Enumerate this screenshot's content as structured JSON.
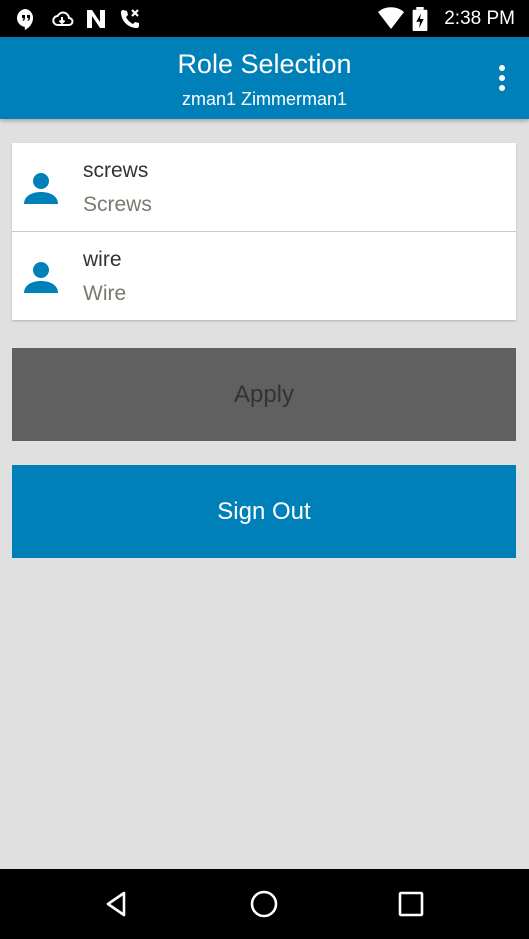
{
  "status_bar": {
    "time": "2:38 PM",
    "icons": [
      "hangouts-icon",
      "cloud-download-icon",
      "nfc-icon",
      "missed-call-icon",
      "wifi-icon",
      "battery-charging-icon"
    ]
  },
  "app_bar": {
    "title": "Role Selection",
    "subtitle": "zman1 Zimmerman1",
    "menu_icon": "more-vert-icon"
  },
  "roles": [
    {
      "name": "screws",
      "description": "Screws",
      "icon": "person-icon"
    },
    {
      "name": "wire",
      "description": "Wire",
      "icon": "person-icon"
    }
  ],
  "buttons": {
    "apply_label": "Apply",
    "sign_out_label": "Sign Out"
  },
  "nav_bar": {
    "icons": [
      "back-icon",
      "home-icon",
      "recents-icon"
    ]
  },
  "colors": {
    "accent": "#0080b8",
    "apply_button": "#606060",
    "background": "#e0e0e0"
  }
}
